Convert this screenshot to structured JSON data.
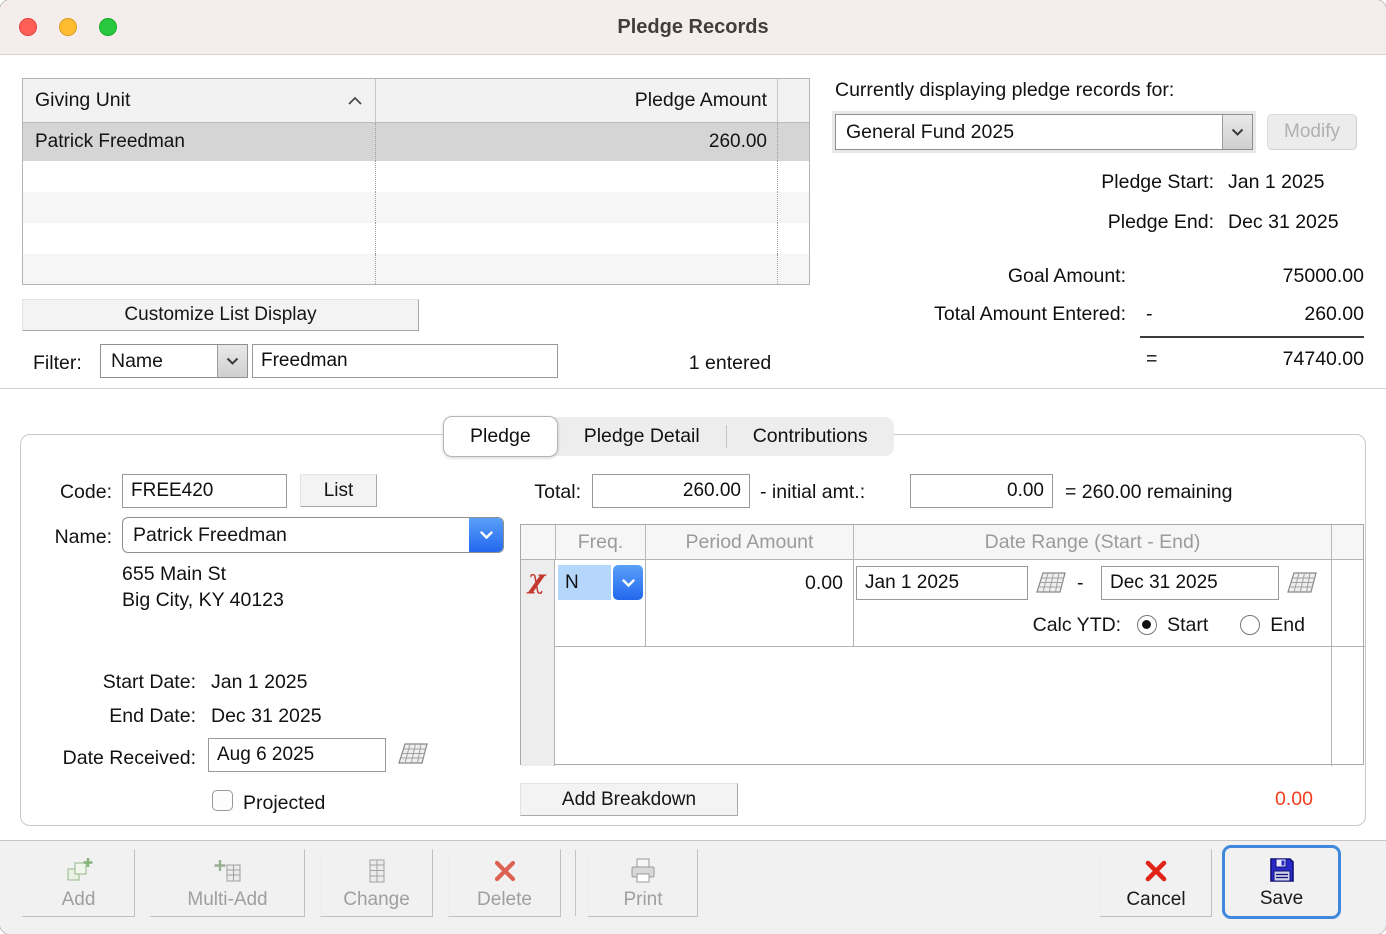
{
  "window": {
    "title": "Pledge Records"
  },
  "colors": {
    "accent_blue": "#2e7bf6",
    "focus_ring_blue": "#3f88dd",
    "alert_red": "#f23c1e",
    "save_icon_blue": "#2929c8",
    "cancel_red": "#e02418"
  },
  "giving_table": {
    "col_unit": "Giving Unit",
    "col_amount": "Pledge Amount",
    "rows": [
      {
        "name": "Patrick Freedman",
        "amount": "260.00"
      }
    ]
  },
  "customize_button_label": "Customize List Display",
  "filter": {
    "label": "Filter:",
    "field": "Name",
    "value": "Freedman",
    "entered": "1 entered"
  },
  "fund_panel": {
    "heading": "Currently displaying pledge records for:",
    "fund": "General Fund 2025",
    "modify": "Modify",
    "start_label": "Pledge Start:",
    "start_value": "Jan 1 2025",
    "end_label": "Pledge End:",
    "end_value": "Dec 31 2025",
    "goal_label": "Goal Amount:",
    "goal_value": "75000.00",
    "entered_label": "Total Amount Entered:",
    "minus": "-",
    "entered_value": "260.00",
    "equals": "=",
    "remaining_value": "74740.00"
  },
  "tabs": {
    "pledge": "Pledge",
    "detail": "Pledge Detail",
    "contributions": "Contributions"
  },
  "form": {
    "code_label": "Code:",
    "code_value": "FREE420",
    "list_button": "List",
    "name_label": "Name:",
    "name_value": "Patrick Freedman",
    "address1": "655 Main St",
    "address2": "Big City, KY 40123",
    "start_label": "Start Date:",
    "start_value": "Jan 1 2025",
    "end_label": "End Date:",
    "end_value": "Dec 31 2025",
    "received_label": "Date Received:",
    "received_value": "Aug 6 2025",
    "projected_label": "Projected",
    "total_label": "Total:",
    "total_value": "260.00",
    "initial_label": "- initial amt.:",
    "initial_value": "0.00",
    "remaining_text": "= 260.00 remaining"
  },
  "breakdown": {
    "headers": [
      "Freq.",
      "Period Amount",
      "Date Range (Start - End)"
    ],
    "chi": "χ",
    "row": {
      "freq": "N",
      "amount": "0.00",
      "start": "Jan 1 2025",
      "dash": "-",
      "end": "Dec 31 2025"
    },
    "calc_label": "Calc YTD:",
    "calc_start": "Start",
    "calc_end": "End",
    "add_button": "Add Breakdown",
    "total": "0.00"
  },
  "toolbar": {
    "add": "Add",
    "multi_add": "Multi-Add",
    "change": "Change",
    "delete": "Delete",
    "print": "Print",
    "cancel": "Cancel",
    "save": "Save"
  }
}
